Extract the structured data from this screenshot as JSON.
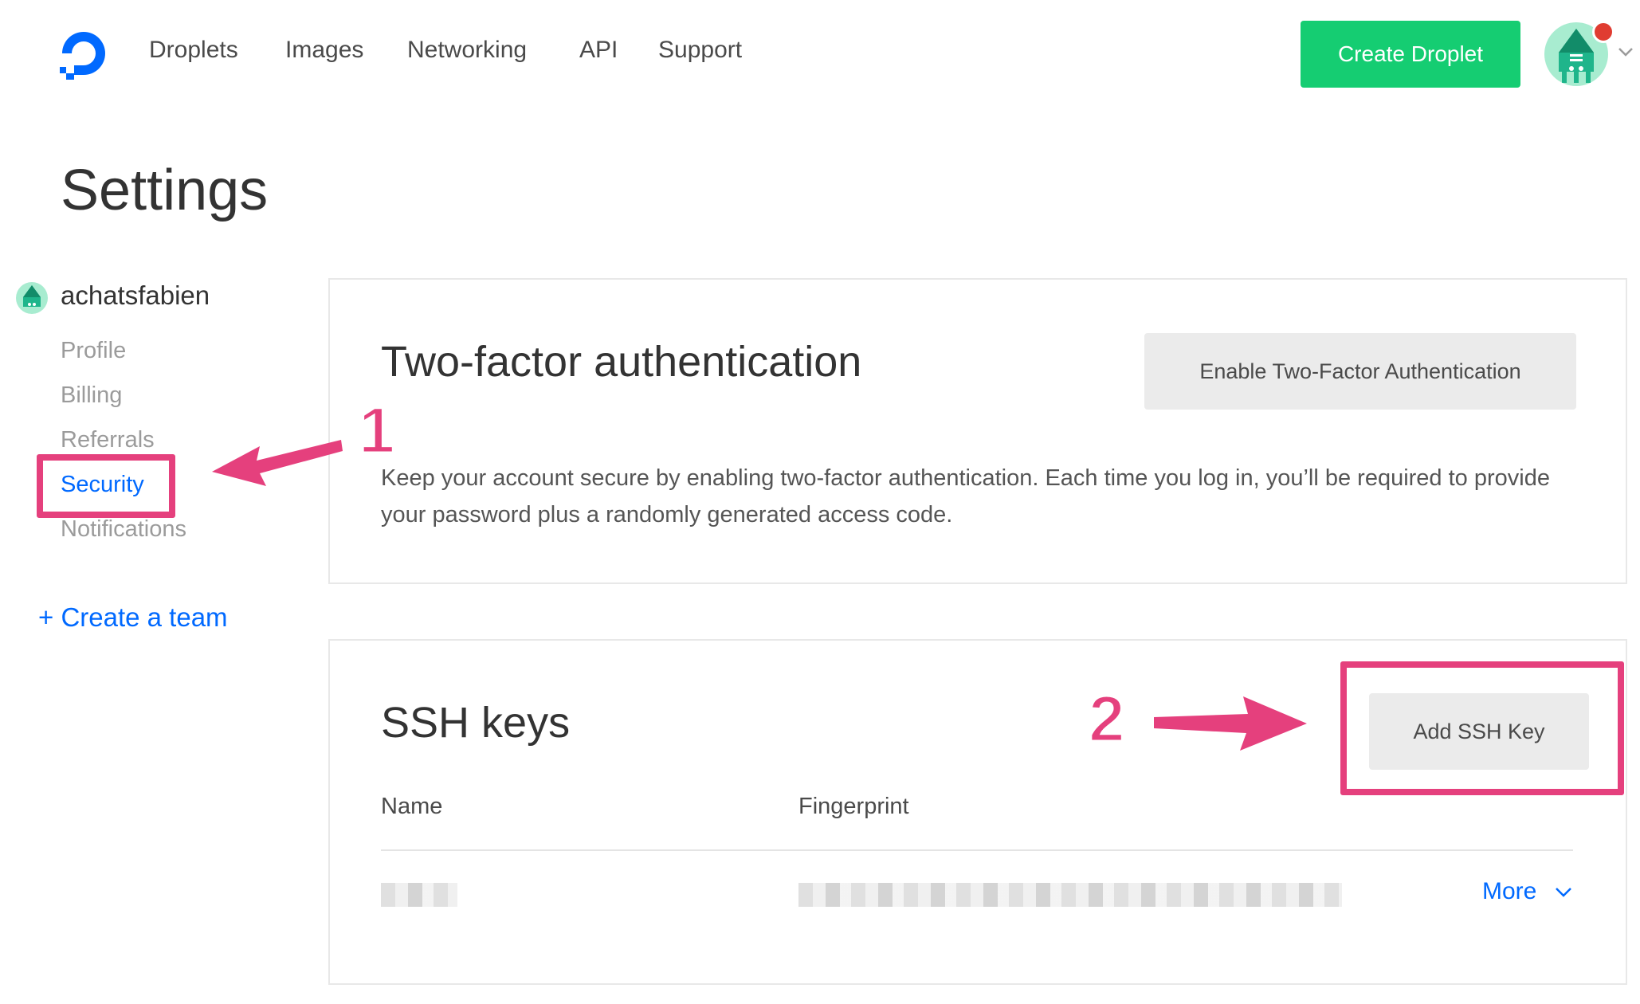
{
  "nav": {
    "items": [
      "Droplets",
      "Images",
      "Networking",
      "API",
      "Support"
    ],
    "create_button": "Create Droplet"
  },
  "page": {
    "title": "Settings"
  },
  "sidebar": {
    "username": "achatsfabien",
    "links": [
      "Profile",
      "Billing",
      "Referrals",
      "Security",
      "Notifications"
    ],
    "active": "Security",
    "create_team": "+ Create a team"
  },
  "two_factor": {
    "heading": "Two-factor authentication",
    "button": "Enable Two-Factor Authentication",
    "description": "Keep your account secure by enabling two-factor authentication. Each time you log in, you’ll be required to provide your password plus a randomly generated access code."
  },
  "ssh_keys": {
    "heading": "SSH keys",
    "button": "Add SSH Key",
    "columns": [
      "Name",
      "Fingerprint"
    ],
    "rows": [
      {
        "more_label": "More"
      }
    ]
  },
  "annotations": {
    "step1": "1",
    "step2": "2",
    "color": "#e5407d"
  },
  "colors": {
    "brand_blue": "#0069ff",
    "create_green": "#15cd72",
    "avatar_bg": "#a8ecd0"
  },
  "icons": {
    "logo": "digitalocean-logo-icon",
    "avatar": "sammy-avatar-icon",
    "notification": "notification-dot-icon",
    "chevron": "chevron-down-icon"
  }
}
